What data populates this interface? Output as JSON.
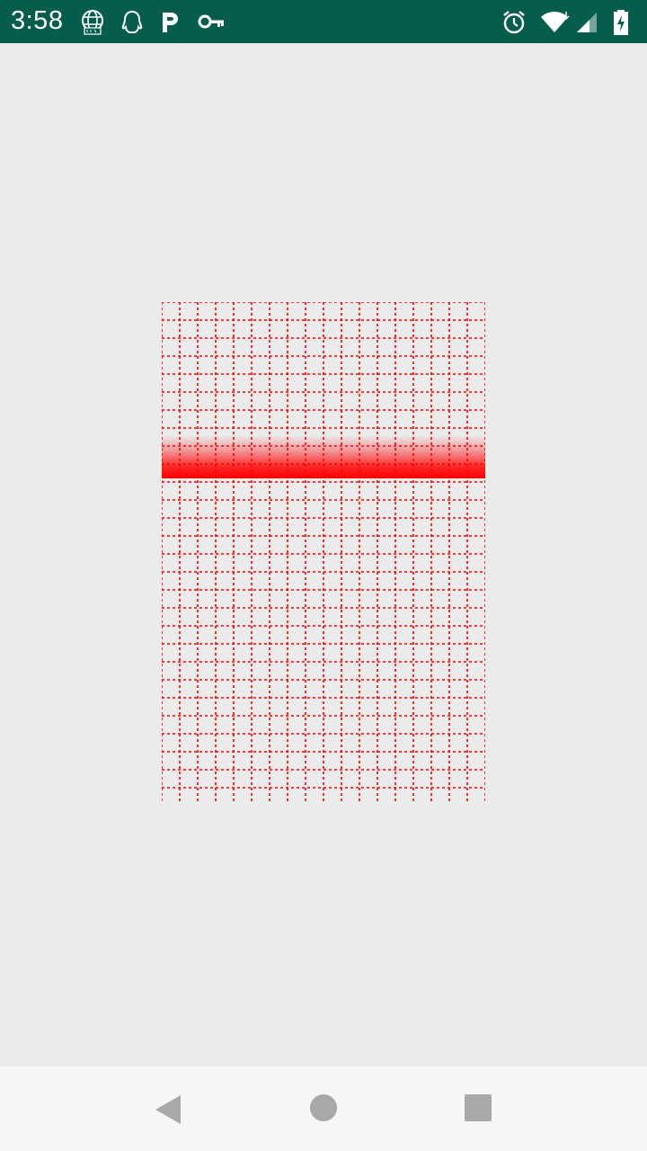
{
  "status_bar": {
    "time": "3:58",
    "background_color": "#075d4c",
    "left_icons": [
      "globe-live-icon",
      "qq-icon",
      "parking-icon",
      "key-icon"
    ],
    "right_icons": [
      "alarm-icon",
      "wifi-icon",
      "signal-icon",
      "battery-charging-icon"
    ]
  },
  "scanner": {
    "grid_color": "#ff0000",
    "scan_line_color": "#ff0000",
    "background_color": "#ebebeb"
  },
  "nav_bar": {
    "buttons": [
      "back-icon",
      "home-icon",
      "recents-icon"
    ],
    "icon_color": "#a9a9a9"
  }
}
